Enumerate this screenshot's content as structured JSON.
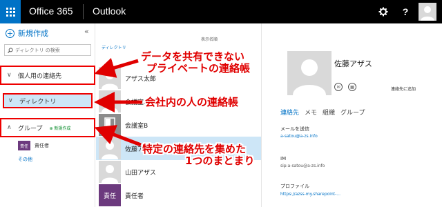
{
  "topbar": {
    "suite_title": "Office 365",
    "app_name": "Outlook",
    "help_label": "?",
    "icons": [
      "app-launcher-icon",
      "gear-icon",
      "user-avatar"
    ]
  },
  "sidebar": {
    "new_label": "新規作成",
    "collapse_label": "«",
    "search_placeholder": "ディレクトリ の検索",
    "items": [
      {
        "label": "個人用の連絡先"
      },
      {
        "label": "ディレクトリ"
      },
      {
        "label": "グループ",
        "new_label": "新規作成"
      }
    ],
    "group_item": {
      "badge": "責任",
      "label": "責任者"
    },
    "more_label": "その他"
  },
  "list": {
    "header": "ディレクトリ",
    "sort_label": "表示名順",
    "contacts": [
      {
        "name": "アザス太郎",
        "kind": "photo"
      },
      {
        "name": "会議室A",
        "kind": "photo"
      },
      {
        "name": "会議室B",
        "kind": "room"
      },
      {
        "name": "佐藤アザス",
        "kind": "photo"
      },
      {
        "name": "山田アザス",
        "kind": "photo"
      },
      {
        "name": "責任者",
        "kind": "initials",
        "initials": "責任"
      }
    ],
    "selected_index": 3
  },
  "detail": {
    "name": "佐藤アザス",
    "add_link": "連絡先に追加",
    "tabs": [
      "連絡先",
      "メモ",
      "組織",
      "グループ"
    ],
    "active_tab": 0,
    "fields": {
      "email_label": "メールを送信",
      "email_value": "a-satou@a-zs.info",
      "im_label": "IM",
      "im_value": "sip:a-satou@a-zs.info",
      "profile_label": "プロファイル",
      "profile_value": "https://azss-my.sharepoint-..."
    }
  },
  "annotations": {
    "a1_line1": "データを共有できない",
    "a1_line2": "プライベートの連絡帳",
    "a2": "会社内の人の連絡帳",
    "a3_line1": "特定の連絡先を集めた",
    "a3_line2": "1つのまとまり"
  },
  "colors": {
    "brand": "#0072c6",
    "topbar": "#000000",
    "selected": "#cde6f7",
    "annotation": "#e00000",
    "group_badge": "#6c3a7e"
  }
}
